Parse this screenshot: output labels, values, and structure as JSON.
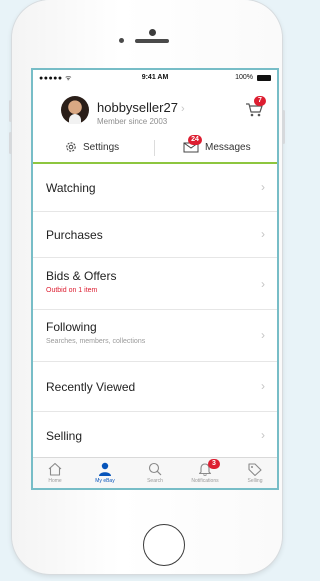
{
  "status_bar": {
    "signal": "●●●●● ᯤ",
    "time": "9:41 AM",
    "battery": "100%"
  },
  "profile": {
    "username": "hobbyseller27",
    "member_since": "Member since 2003",
    "cart_count": "7"
  },
  "actions": {
    "settings_label": "Settings",
    "messages_label": "Messages",
    "messages_count": "24"
  },
  "menu": [
    {
      "label": "Watching",
      "sub": ""
    },
    {
      "label": "Purchases",
      "sub": ""
    },
    {
      "label": "Bids & Offers",
      "sub": "Outbid on 1 item"
    },
    {
      "label": "Following",
      "sub": "Searches, members, collections"
    },
    {
      "label": "Recently Viewed",
      "sub": ""
    },
    {
      "label": "Selling",
      "sub": ""
    }
  ],
  "tabbar": {
    "home": "Home",
    "my_ebay": "My eBay",
    "search": "Search",
    "notifications": "Notifications",
    "notifications_count": "3",
    "selling": "Selling"
  },
  "colors": {
    "accent_green": "#8dc63f",
    "badge_red": "#dd1e31",
    "active_blue": "#0654ba",
    "screen_border": "#77bdc7"
  },
  "icons": [
    "cart-icon",
    "gear-icon",
    "envelope-icon",
    "chevron-right-icon",
    "home-icon",
    "person-icon",
    "search-icon",
    "bell-icon",
    "tag-icon"
  ]
}
